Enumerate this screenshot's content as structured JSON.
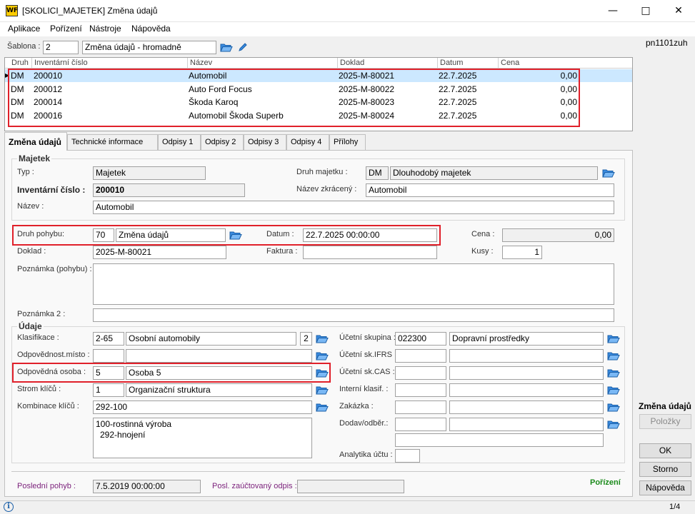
{
  "window": {
    "title": "[SKOLICI_MAJETEK] Změna údajů",
    "logo": "WF",
    "user_code": "pn1101zuh"
  },
  "menu": [
    "Aplikace",
    "Pořízení",
    "Nástroje",
    "Nápověda"
  ],
  "template": {
    "label": "Šablona :",
    "code": "2",
    "name": "Změna údajů - hromadně"
  },
  "grid": {
    "headers": [
      "Druh",
      "Inventární číslo",
      "Název",
      "Doklad",
      "Datum",
      "Cena"
    ],
    "rows": [
      {
        "druh": "DM",
        "inv": "200010",
        "nazev": "Automobil",
        "doklad": "2025-M-80021",
        "datum": "22.7.2025",
        "cena": "0,00"
      },
      {
        "druh": "DM",
        "inv": "200012",
        "nazev": "Auto Ford Focus",
        "doklad": "2025-M-80022",
        "datum": "22.7.2025",
        "cena": "0,00"
      },
      {
        "druh": "DM",
        "inv": "200014",
        "nazev": "Škoda Karoq",
        "doklad": "2025-M-80023",
        "datum": "22.7.2025",
        "cena": "0,00"
      },
      {
        "druh": "DM",
        "inv": "200016",
        "nazev": "Automobil Škoda Superb",
        "doklad": "2025-M-80024",
        "datum": "22.7.2025",
        "cena": "0,00"
      }
    ]
  },
  "tabs": [
    "Změna údajů",
    "Technické informace",
    "Odpisy 1",
    "Odpisy 2",
    "Odpisy 3",
    "Odpisy 4",
    "Přílohy"
  ],
  "majetek": {
    "title": "Majetek",
    "typ_label": "Typ :",
    "typ": "Majetek",
    "druh_label": "Druh majetku :",
    "druh_code": "DM",
    "druh_name": "Dlouhodobý majetek",
    "inv_label": "Inventární číslo :",
    "inv": "200010",
    "zkr_label": "Název zkrácený :",
    "zkr": "Automobil",
    "nazev_label": "Název :",
    "nazev": "Automobil"
  },
  "pohyb": {
    "druh_label": "Druh pohybu:",
    "druh_code": "70",
    "druh_name": "Změna údajů",
    "datum_label": "Datum :",
    "datum": "22.7.2025 00:00:00",
    "cena_label": "Cena :",
    "cena": "0,00",
    "doklad_label": "Doklad :",
    "doklad": "2025-M-80021",
    "faktura_label": "Faktura :",
    "faktura": "",
    "kusy_label": "Kusy :",
    "kusy": "1",
    "poznamka_label": "Poznámka (pohybu) :",
    "poznamka2_label": "Poznámka 2 :"
  },
  "udaje": {
    "title": "Údaje",
    "klas_label": "Klasifikace :",
    "klas_code": "2-65",
    "klas_name": "Osobní automobily",
    "klas_num": "2",
    "misto_label": "Odpovědnost.místo :",
    "osoba_label": "Odpovědná osoba :",
    "osoba_code": "5",
    "osoba_name": "Osoba 5",
    "strom_label": "Strom klíčů :",
    "strom_code": "1",
    "strom_name": "Organizační struktura",
    "komb_label": "Kombinace klíčů :",
    "komb": "292-100",
    "komb_text1": "100-rostinná výroba",
    "komb_text2": "292-hnojení",
    "ucet_label": "Účetní skupina :",
    "ucet_code": "022300",
    "ucet_name": "Dopravní prostředky",
    "ifrs_label": "Účetní sk.IFRS :",
    "cas_label": "Účetní sk.CAS :",
    "intklas_label": "Interní klasif. :",
    "zakazka_label": "Zakázka :",
    "dodav_label": "Dodav/odběr.:",
    "analytika_label": "Analytika účtu :"
  },
  "footer": {
    "posl_label": "Poslední pohyb :",
    "posl": "7.5.2019 00:00:00",
    "odpis_label": "Posl. zaúčtovaný odpis :",
    "odpis": "",
    "porizeni": "Pořízení"
  },
  "sidepanel": {
    "title": "Změna údajů",
    "polozky": "Položky",
    "ok": "OK",
    "storno": "Storno",
    "napoveda": "Nápověda"
  },
  "status": {
    "page": "1/4"
  },
  "colors": {
    "selection": "#cce8ff",
    "highlight": "#e0202a",
    "purple": "#7a1f7a",
    "green": "#1a8a1a"
  }
}
